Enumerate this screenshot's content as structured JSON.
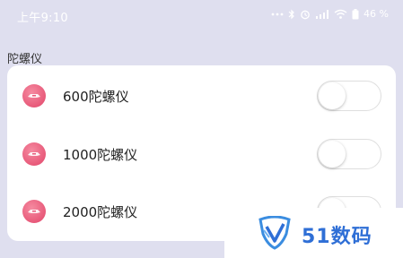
{
  "status_bar": {
    "time": "上午9:10",
    "icons": [
      "dots-icon",
      "bluetooth-icon",
      "alarm-icon",
      "signal-icon",
      "wifi-icon",
      "battery-icon"
    ],
    "battery": "46"
  },
  "section": {
    "title": "陀螺仪"
  },
  "items": [
    {
      "label": "600陀螺仪",
      "icon": "gyroscope-icon",
      "toggle_on": false
    },
    {
      "label": "1000陀螺仪",
      "icon": "gyroscope-icon",
      "toggle_on": false
    },
    {
      "label": "2000陀螺仪",
      "icon": "gyroscope-icon",
      "toggle_on": false
    }
  ],
  "watermark": {
    "text": "51数码"
  },
  "colors": {
    "background": "#dfdfef",
    "card": "#ffffff",
    "icon_accent": "#e85a7a",
    "watermark_blue": "#2f6fd6"
  }
}
